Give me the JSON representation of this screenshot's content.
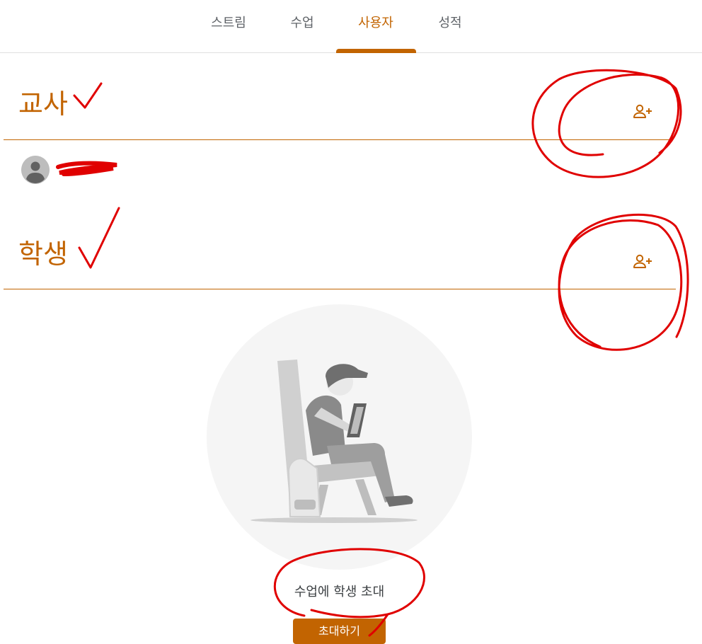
{
  "tabs": [
    {
      "label": "스트림"
    },
    {
      "label": "수업"
    },
    {
      "label": "사용자"
    },
    {
      "label": "성적"
    }
  ],
  "active_tab": "사용자",
  "teachers": {
    "title": "교사",
    "add_icon": "person-add-icon"
  },
  "students": {
    "title": "학생",
    "add_icon": "person-add-icon"
  },
  "empty_state": {
    "message": "수업에 학생 초대",
    "button_label": "초대하기"
  },
  "colors": {
    "accent": "#c26401",
    "annotation": "#e00000"
  }
}
